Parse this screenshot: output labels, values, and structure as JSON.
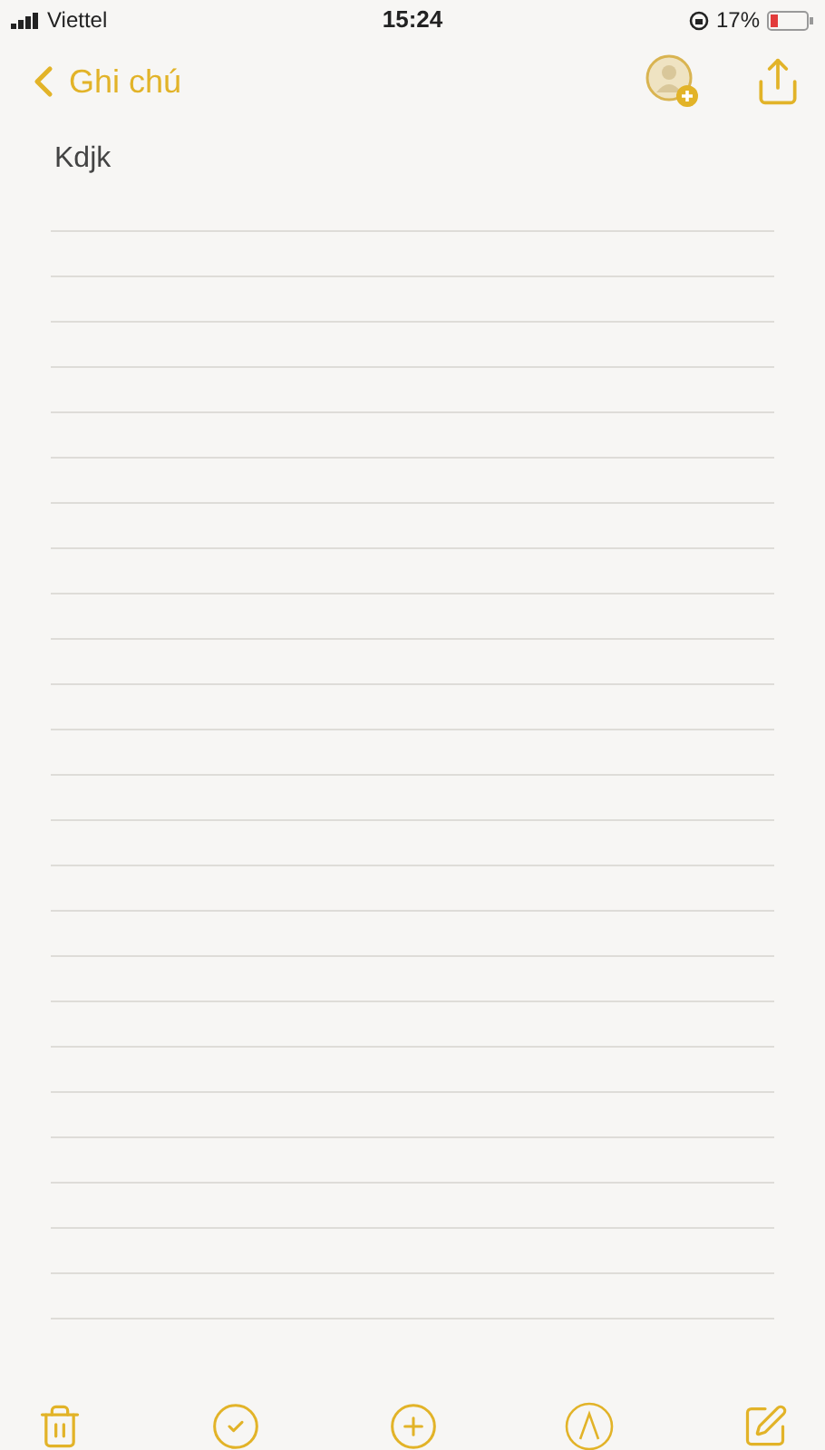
{
  "status_bar": {
    "carrier": "Viettel",
    "time": "15:24",
    "battery": "17%"
  },
  "nav": {
    "back": "Ghi chú"
  },
  "note": {
    "title": "Kdjk"
  }
}
